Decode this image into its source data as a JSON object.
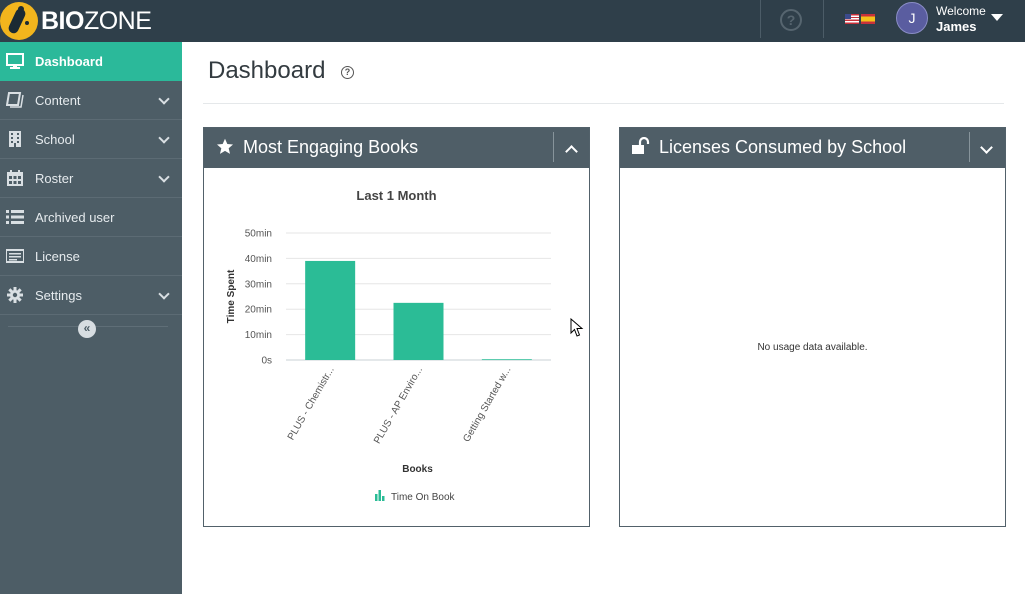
{
  "brand": {
    "name_bold": "BIO",
    "name_rest": "ZONE"
  },
  "header": {
    "help_glyph": "?",
    "user": {
      "initial": "J",
      "welcome": "Welcome",
      "name": "James"
    }
  },
  "sidebar": {
    "items": [
      {
        "label": "Dashboard",
        "icon": "monitor-icon",
        "active": true
      },
      {
        "label": "Content",
        "icon": "book-icon",
        "expandable": true
      },
      {
        "label": "School",
        "icon": "building-icon",
        "expandable": true
      },
      {
        "label": "Roster",
        "icon": "calendar-icon",
        "expandable": true
      },
      {
        "label": "Archived user",
        "icon": "list-icon"
      },
      {
        "label": "License",
        "icon": "license-card-icon"
      },
      {
        "label": "Settings",
        "icon": "gear-icon",
        "expandable": true
      }
    ],
    "collapse_glyph": "«"
  },
  "page": {
    "title": "Dashboard",
    "help_glyph": "?"
  },
  "panels": {
    "engaging": {
      "title": "Most Engaging Books",
      "icon": "star-icon"
    },
    "licenses": {
      "title": "Licenses Consumed by School",
      "icon": "unlock-icon",
      "empty_message": "No usage data available."
    }
  },
  "chart_data": {
    "type": "bar",
    "title": "Last 1 Month",
    "xlabel": "Books",
    "ylabel": "Time Spent",
    "categories": [
      "PLUS - Chemistr...",
      "PLUS - AP Enviro...",
      "Getting Started w..."
    ],
    "series": [
      {
        "name": "Time On Book",
        "values": [
          39,
          22.5,
          0.3
        ],
        "color": "#2bbc96"
      }
    ],
    "y_ticks": [
      "0s",
      "10min",
      "20min",
      "30min",
      "40min",
      "50min"
    ],
    "ylim": [
      0,
      50
    ],
    "grid": true,
    "legend": "bottom"
  }
}
